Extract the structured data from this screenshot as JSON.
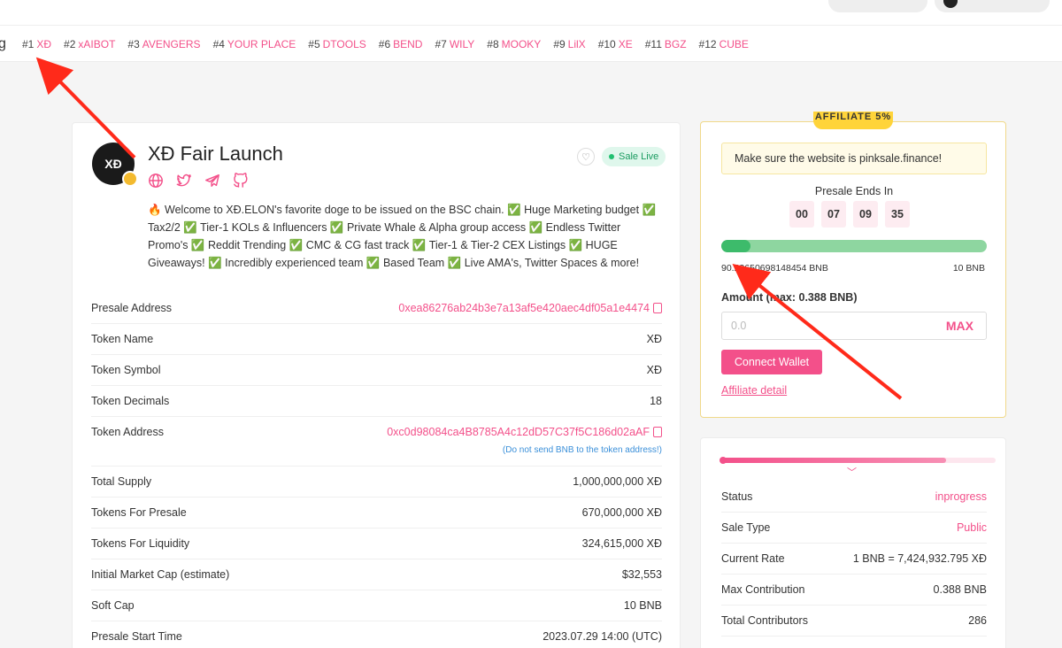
{
  "header": {
    "pill1_label": "",
    "pill2_label": ""
  },
  "trending": {
    "prefix": "g",
    "items": [
      {
        "rank": "#1",
        "symbol": "ΧĐ"
      },
      {
        "rank": "#2",
        "symbol": "xAIBOT"
      },
      {
        "rank": "#3",
        "symbol": "AVENGERS"
      },
      {
        "rank": "#4",
        "symbol": "YOUR PLACE"
      },
      {
        "rank": "#5",
        "symbol": "DTOOLS"
      },
      {
        "rank": "#6",
        "symbol": "BEND"
      },
      {
        "rank": "#7",
        "symbol": "WILY"
      },
      {
        "rank": "#8",
        "symbol": "MOOKY"
      },
      {
        "rank": "#9",
        "symbol": "LilX"
      },
      {
        "rank": "#10",
        "symbol": "XE"
      },
      {
        "rank": "#11",
        "symbol": "BGZ"
      },
      {
        "rank": "#12",
        "symbol": "CUBE"
      }
    ]
  },
  "project": {
    "logo_text": "XĐ",
    "title": "ΧĐ Fair Launch",
    "status": "Sale Live",
    "description": "🔥 Welcome to ΧĐ.ELON's favorite doge to be issued on the BSC chain. ✅ Huge Marketing budget ✅ Tax2/2 ✅ Tier-1 KOLs & Influencers ✅ Private Whale & Alpha group access ✅ Endless Twitter Promo's ✅ Reddit Trending ✅ CMC & CG fast track ✅ Tier-1 & Tier-2 CEX Listings ✅ HUGE Giveaways! ✅ Incredibly experienced team ✅ Based Team ✅ Live AMA's, Twitter Spaces & more!",
    "socials": [
      "globe-icon",
      "twitter-icon",
      "telegram-icon",
      "github-icon"
    ]
  },
  "details": {
    "presale_address": {
      "label": "Presale Address",
      "value": "0xea86276ab24b3e7a13af5e420aec4df05a1e4474"
    },
    "token_name": {
      "label": "Token Name",
      "value": "ΧĐ"
    },
    "token_symbol": {
      "label": "Token Symbol",
      "value": "ΧĐ"
    },
    "token_decimals": {
      "label": "Token Decimals",
      "value": "18"
    },
    "token_address": {
      "label": "Token Address",
      "value": "0xc0d98084ca4B8785A4c12dD57C37f5C186d02aAF",
      "note": "(Do not send BNB to the token address!)"
    },
    "total_supply": {
      "label": "Total Supply",
      "value": "1,000,000,000 ΧĐ"
    },
    "tokens_presale": {
      "label": "Tokens For Presale",
      "value": "670,000,000 ΧĐ"
    },
    "tokens_liquidity": {
      "label": "Tokens For Liquidity",
      "value": "324,615,000 ΧĐ"
    },
    "market_cap": {
      "label": "Initial Market Cap (estimate)",
      "value": "$32,553"
    },
    "soft_cap": {
      "label": "Soft Cap",
      "value": "10 BNB"
    },
    "start_time": {
      "label": "Presale Start Time",
      "value": "2023.07.29 14:00 (UTC)"
    }
  },
  "purchase": {
    "affiliate_tag": "AFFILIATE 5%",
    "warning": "Make sure the website is pinksale.finance!",
    "ends_label": "Presale Ends In",
    "countdown": [
      "00",
      "07",
      "09",
      "35"
    ],
    "raised": "90.23650698148454 BNB",
    "target": "10 BNB",
    "progress_fraction": 0.11,
    "amount_label": "Amount (max: 0.388 BNB)",
    "amount_placeholder": "0.0",
    "max_label": "MAX",
    "connect_label": "Connect Wallet",
    "affiliate_link": "Affiliate detail"
  },
  "status_panel": {
    "progress_fraction": 0.82,
    "rows": [
      {
        "label": "Status",
        "value": "inprogress"
      },
      {
        "label": "Sale Type",
        "value": "Public"
      },
      {
        "label": "Current Rate",
        "value": "1 BNB = 7,424,932.795 ΧĐ"
      },
      {
        "label": "Max Contribution",
        "value": "0.388 BNB"
      },
      {
        "label": "Total Contributors",
        "value": "286"
      }
    ]
  },
  "colors": {
    "accent": "#f3508a",
    "success": "#3dbb6b",
    "annotation": "#ff2a1a"
  }
}
